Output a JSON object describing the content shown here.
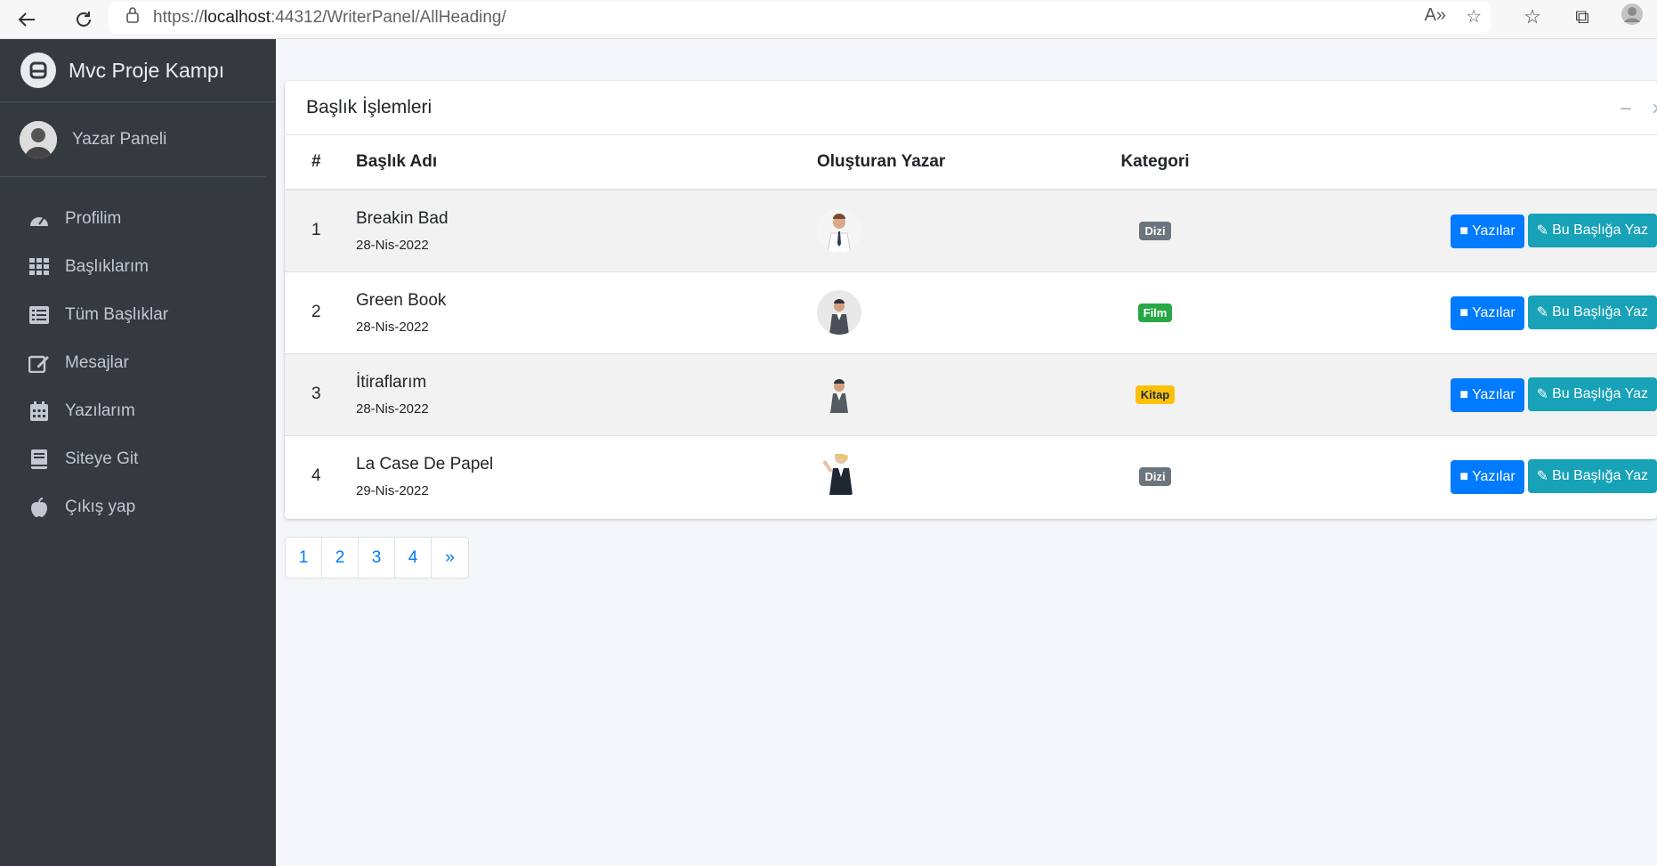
{
  "browser": {
    "url_prefix": "https://",
    "url_host": "localhost",
    "url_rest": ":44312/WriterPanel/AllHeading/"
  },
  "sidebar": {
    "brand": "Mvc Proje Kampı",
    "user_name": "Yazar Paneli",
    "items": [
      {
        "label": "Profilim",
        "icon": "tachometer-icon"
      },
      {
        "label": "Başlıklarım",
        "icon": "grid-icon"
      },
      {
        "label": "Tüm Başlıklar",
        "icon": "list-icon"
      },
      {
        "label": "Mesajlar",
        "icon": "edit-icon"
      },
      {
        "label": "Yazılarım",
        "icon": "calendar-icon"
      },
      {
        "label": "Siteye Git",
        "icon": "book-icon"
      },
      {
        "label": "Çıkış yap",
        "icon": "apple-icon"
      }
    ]
  },
  "card": {
    "title": "Başlık İşlemleri",
    "columns": [
      "#",
      "Başlık Adı",
      "Oluşturan Yazar",
      "Kategori"
    ],
    "rows": [
      {
        "num": "1",
        "title": "Breakin Bad",
        "date": "28-Nis-2022",
        "category": "Dizi",
        "badge_color": "#6c757d"
      },
      {
        "num": "2",
        "title": "Green Book",
        "date": "28-Nis-2022",
        "category": "Film",
        "badge_color": "#28a745"
      },
      {
        "num": "3",
        "title": "İtiraflarım",
        "date": "28-Nis-2022",
        "category": "Kitap",
        "badge_color": "#ffc107"
      },
      {
        "num": "4",
        "title": "La Case De Papel",
        "date": "29-Nis-2022",
        "category": "Dizi",
        "badge_color": "#6c757d"
      }
    ],
    "btn_posts": "Yazılar",
    "btn_write": "Bu Başlığa Yaz"
  },
  "pagination": [
    "1",
    "2",
    "3",
    "4",
    "»"
  ]
}
